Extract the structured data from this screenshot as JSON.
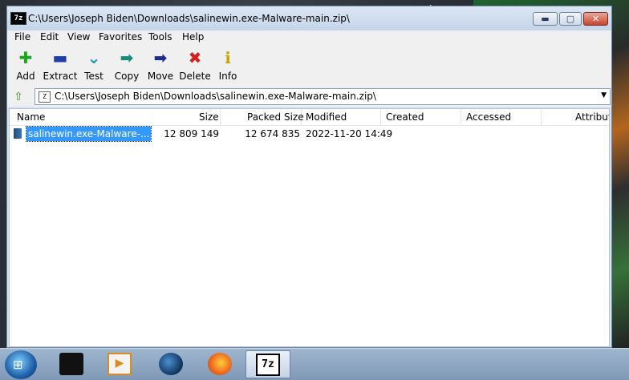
{
  "window": {
    "title": "C:\\Users\\Joseph Biden\\Downloads\\salinewin.exe-Malware-main.zip\\",
    "app_icon_text": "7z",
    "minimize_glyph": "▬",
    "maximize_glyph": "▢",
    "close_glyph": "✕"
  },
  "menu": [
    "File",
    "Edit",
    "View",
    "Favorites",
    "Tools",
    "Help"
  ],
  "toolbar": [
    {
      "label": "Add",
      "icon": "plus-icon",
      "glyph": "✚",
      "color": "#1fa51f"
    },
    {
      "label": "Extract",
      "icon": "minus-icon",
      "glyph": "▬",
      "color": "#1f3fa8"
    },
    {
      "label": "Test",
      "icon": "check-chevron-icon",
      "glyph": "⌄",
      "color": "#1c9bb0"
    },
    {
      "label": "Copy",
      "icon": "copy-arrow-icon",
      "glyph": "➡",
      "color": "#1a8a78"
    },
    {
      "label": "Move",
      "icon": "move-arrow-icon",
      "glyph": "➡",
      "color": "#1c2f8a"
    },
    {
      "label": "Delete",
      "icon": "delete-x-icon",
      "glyph": "✖",
      "color": "#d21f1f"
    },
    {
      "label": "Info",
      "icon": "info-icon",
      "glyph": "i",
      "color": "#c9a400"
    }
  ],
  "address": {
    "path": "C:\\Users\\Joseph Biden\\Downloads\\salinewin.exe-Malware-main.zip\\",
    "icon_text": "Z",
    "up_glyph": "⇧",
    "dropdown_glyph": "▼"
  },
  "columns": [
    "Name",
    "Size",
    "Packed Size",
    "Modified",
    "Created",
    "Accessed",
    "Attributes"
  ],
  "rows": [
    {
      "name": "salinewin.exe-Malware-...",
      "size": "12 809 149",
      "packed": "12 674 835",
      "modified": "2022-11-20 14:49",
      "created": "",
      "accessed": "",
      "attributes": ""
    }
  ],
  "taskbar": {
    "start_glyph": "⊞",
    "media_glyph": "▶",
    "sevenzip_label": "7z"
  },
  "cursor_glyph": "↕",
  "colors": {
    "selection": "#3399ff",
    "window_frame": "#d9e4f1"
  }
}
